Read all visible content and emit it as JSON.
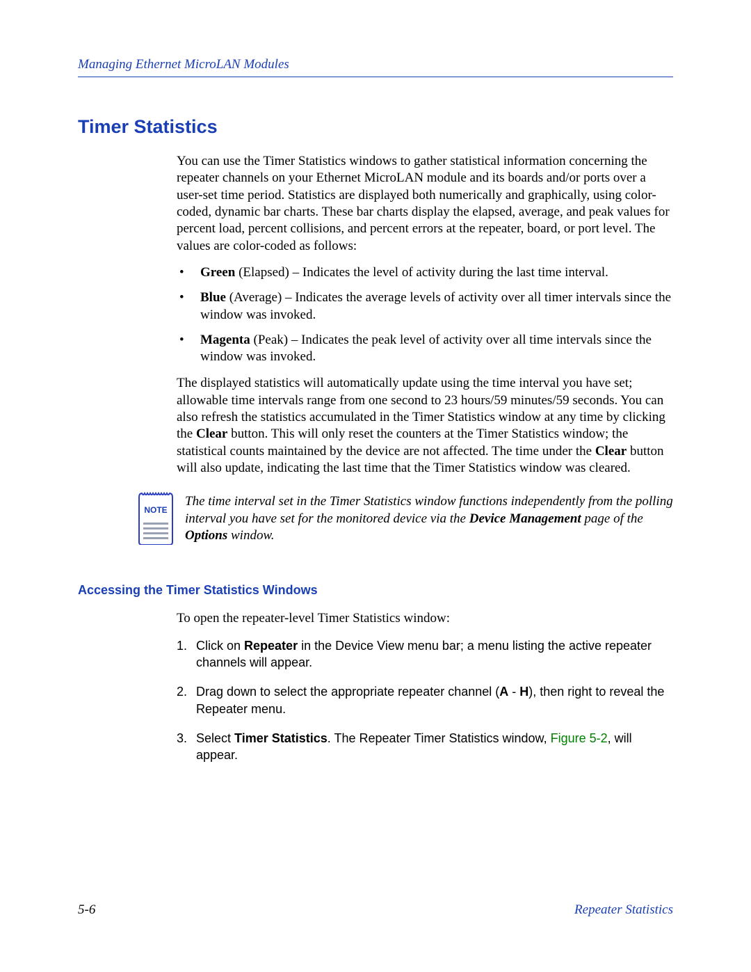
{
  "header": {
    "running": "Managing Ethernet MicroLAN Modules"
  },
  "section": {
    "title": "Timer Statistics",
    "intro": "You can use the Timer Statistics windows to gather statistical information concerning the repeater channels on your Ethernet MicroLAN module and its boards and/or ports over a user-set time period. Statistics are displayed both numerically and graphically, using color-coded, dynamic bar charts. These bar charts display the elapsed, average, and peak values for percent load, percent collisions, and percent errors at the repeater, board, or port level. The values are color-coded as follows:",
    "bullets": [
      {
        "label": "Green",
        "paren": "(Elapsed)",
        "desc": "– Indicates the level of activity during the last time interval."
      },
      {
        "label": "Blue",
        "paren": "(Average)",
        "desc": "– Indicates the average levels of activity over all timer intervals since the window was invoked."
      },
      {
        "label": "Magenta",
        "paren": "(Peak)",
        "desc": "– Indicates the peak level of activity over all time intervals since the window was invoked."
      }
    ],
    "para2_pre": "The displayed statistics will automatically update using the time interval you have set; allowable time intervals range from one second to 23 hours/59 minutes/59 seconds. You can also refresh the statistics accumulated in the Timer Statistics window at any time by clicking the ",
    "para2_b1": "Clear",
    "para2_mid": " button. This will only reset the counters at the Timer Statistics window; the statistical counts maintained by the device are not affected. The time under the ",
    "para2_b2": "Clear",
    "para2_post": " button will also update, indicating the last time that the Timer Statistics window was cleared."
  },
  "note": {
    "badge": "NOTE",
    "text_pre": "The time interval set in the Timer Statistics window functions independently from the polling interval you have set for the monitored device via the ",
    "bold1": "Device Management",
    "mid": " page of the ",
    "bold2": "Options",
    "post": " window."
  },
  "subsection": {
    "heading": "Accessing the Timer Statistics Windows",
    "lead": "To open the repeater-level Timer Statistics window:",
    "steps": {
      "s1_num": "1.",
      "s1_a": "Click on ",
      "s1_b": "Repeater",
      "s1_c": " in the Device View menu bar; a menu listing the active repeater channels will appear.",
      "s2_num": "2.",
      "s2_a": "Drag down to select the appropriate repeater channel (",
      "s2_b1": "A",
      "s2_mid": " - ",
      "s2_b2": "H",
      "s2_c": "), then right to reveal the Repeater menu.",
      "s3_num": "3.",
      "s3_a": "Select ",
      "s3_b": "Timer Statistics",
      "s3_c": ". The Repeater Timer Statistics window, ",
      "s3_fig": "Figure 5-2",
      "s3_d": ", will appear."
    }
  },
  "footer": {
    "page": "5-6",
    "section": "Repeater Statistics"
  }
}
